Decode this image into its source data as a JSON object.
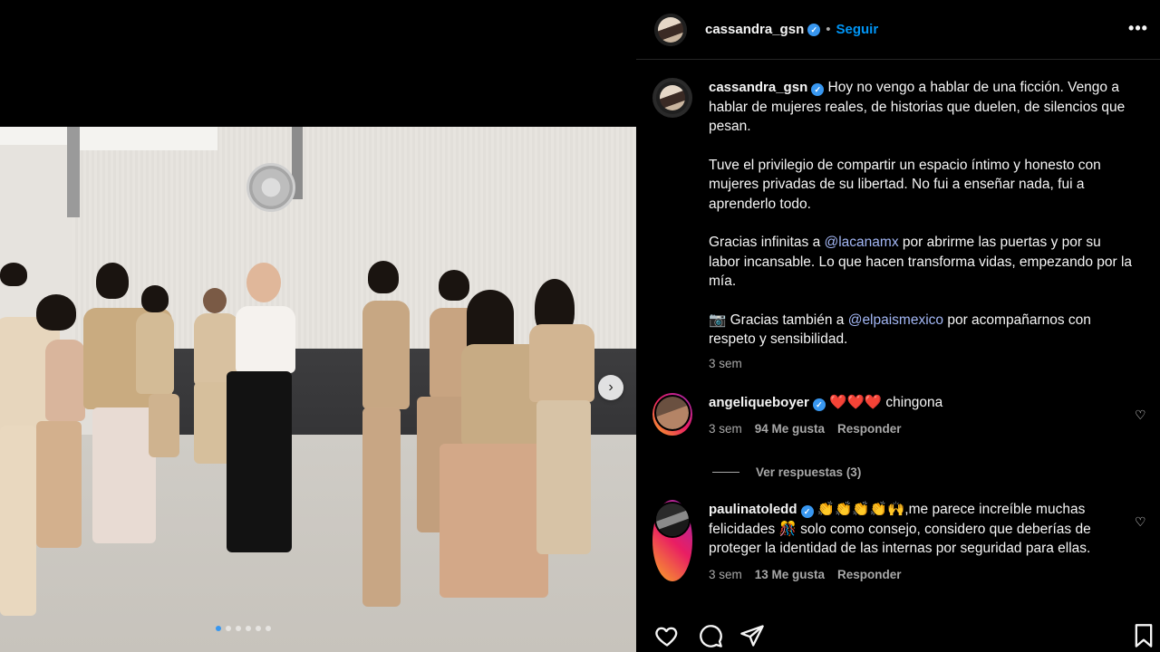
{
  "post": {
    "username": "cassandra_gsn",
    "follow_label": "Seguir",
    "separator": "•",
    "more_label": "•••",
    "carousel": {
      "slide_count": 6,
      "active_index": 0,
      "next_glyph": "›"
    }
  },
  "caption": {
    "username": "cassandra_gsn",
    "paragraphs": [
      "Hoy no vengo a hablar de una ficción. Vengo a hablar de mujeres reales, de historias que duelen, de silencios que pesan.",
      "Tuve el privilegio de compartir un espacio íntimo y honesto con mujeres privadas de su libertad. No fui a enseñar nada, fui a aprenderlo todo.",
      "",
      "📷 Gracias también a "
    ],
    "p3_before": "Gracias infinitas a ",
    "p3_mention": "@lacanamx",
    "p3_after": " por abrirme las puertas y por su labor incansable. Lo que hacen transforma vidas, empezando por la mía.",
    "p4_before": "📷 Gracias también a ",
    "p4_mention": "@elpaismexico",
    "p4_after": " por acompañarnos con respeto y sensibilidad.",
    "time": "3 sem"
  },
  "comments": [
    {
      "username": "angeliqueboyer",
      "text": "❤️❤️❤️ chingona",
      "time": "3 sem",
      "likes": "94 Me gusta",
      "reply_label": "Responder"
    },
    {
      "username": "paulinatoledd",
      "text": "👏👏👏👏🙌,me parece increíble muchas felicidades 🎊 solo como consejo, considero que deberías de proteger la identidad de las internas por seguridad para ellas.",
      "time": "3 sem",
      "likes": "13 Me gusta",
      "reply_label": "Responder"
    }
  ],
  "view_replies_label": "Ver respuestas (3)",
  "icons": {
    "verified": "✓",
    "heart_small": "♡"
  },
  "colors": {
    "background": "#000000",
    "link_blue": "#0095f6",
    "mention": "#a3b7f5",
    "verified": "#3897f0",
    "secondary_text": "#a8a8a8"
  }
}
